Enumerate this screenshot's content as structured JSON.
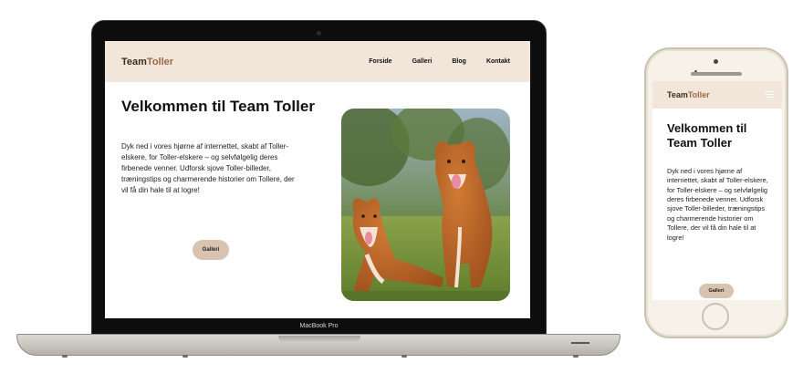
{
  "laptop": {
    "model_label": "MacBook Pro",
    "site": {
      "logo": {
        "team": "Team",
        "toller": "Toller"
      },
      "nav": [
        "Forside",
        "Galleri",
        "Blog",
        "Kontakt"
      ],
      "hero_title": "Velkommen til Team Toller",
      "hero_text": "Dyk ned i vores hjørne af internettet, skabt af Toller-elskere, for Toller-elskere – og selvfølgelig deres firbenede venner. Udforsk sjove Toller-billeder, træningstips og charmerende historier om Tollere, der vil få din hale til at logre!",
      "button_label": "Galleri",
      "photo": "two-nova-scotia-duck-tolling-retrievers-on-grass"
    }
  },
  "phone": {
    "site": {
      "logo": {
        "team": "Team",
        "toller": "Toller"
      },
      "menu_icon": "hamburger-icon",
      "hero_title": "Velkommen til Team Toller",
      "hero_text": "Dyk ned i vores hjørne af internettet, skabt af Toller-elskere, for Toller-elskere – og selvfølgelig deres firbenede venner. Udforsk sjove Toller-billeder, træningstips og charmerende historier om Tollere, der vil få din hale til at logre!",
      "button_label": "Galleri"
    }
  },
  "colors": {
    "nav_background": "#f2e6da",
    "logo_dark": "#3f2a1f",
    "logo_accent": "#9c6a45",
    "button_background": "#d8c2b0"
  }
}
